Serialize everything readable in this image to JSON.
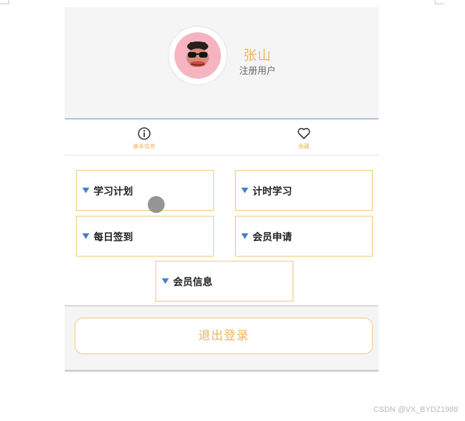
{
  "profile": {
    "name": "张山",
    "role": "注册用户",
    "avatar_icon": "monkey-avatar-icon"
  },
  "tabs": [
    {
      "label": "基本信息",
      "icon": "info-icon"
    },
    {
      "label": "收藏",
      "icon": "heart-icon"
    }
  ],
  "menu": {
    "items": [
      {
        "label": "学习计划"
      },
      {
        "label": "计时学习"
      },
      {
        "label": "每日签到"
      },
      {
        "label": "会员申请"
      },
      {
        "label": "会员信息"
      }
    ]
  },
  "logout": {
    "label": "退出登录"
  },
  "watermark": "CSDN @VX_BYDZ1988",
  "colors": {
    "accent": "#f0b35a",
    "border": "#f0c878",
    "triangle": "#4a7fc1",
    "header_bg": "#f5f5f5"
  }
}
